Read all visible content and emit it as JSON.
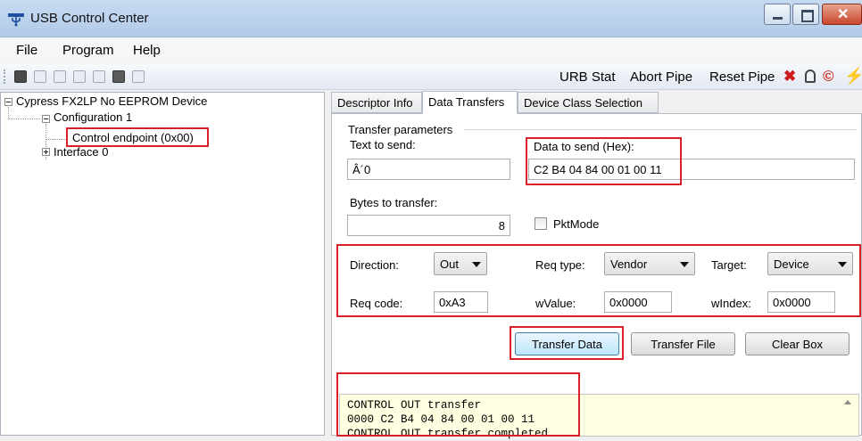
{
  "window": {
    "title": "USB Control Center"
  },
  "menu": {
    "items": [
      "File",
      "Program",
      "Help"
    ]
  },
  "toolbar": {
    "urb_stat": "URB Stat",
    "abort_pipe": "Abort Pipe",
    "reset_pipe": "Reset Pipe"
  },
  "tree": {
    "device": "Cypress FX2LP No EEPROM Device",
    "configuration": "Configuration 1",
    "endpoint": "Control endpoint (0x00)",
    "interface": "Interface 0"
  },
  "tabs": [
    "Descriptor Info",
    "Data Transfers",
    "Device Class Selection"
  ],
  "transfer": {
    "group_label": "Transfer parameters",
    "text_to_send_label": "Text to send:",
    "text_to_send_value": "Â´0",
    "hex_label": "Data to send (Hex):",
    "hex_value": "C2 B4 04 84 00 01 00 11",
    "bytes_label": "Bytes to transfer:",
    "bytes_value": "8",
    "pktmode_label": "PktMode",
    "direction_label": "Direction:",
    "direction_value": "Out",
    "reqtype_label": "Req type:",
    "reqtype_value": "Vendor",
    "target_label": "Target:",
    "target_value": "Device",
    "reqcode_label": "Req code:",
    "reqcode_value": "0xA3",
    "wvalue_label": "wValue:",
    "wvalue_value": "0x0000",
    "windex_label": "wIndex:",
    "windex_value": "0x0000"
  },
  "buttons": {
    "transfer_data": "Transfer Data",
    "transfer_file": "Transfer File",
    "clear_box": "Clear Box"
  },
  "output": {
    "lines": [
      "CONTROL OUT transfer",
      "0000 C2 B4 04 84 00 01 00 11",
      "CONTROL OUT transfer completed"
    ]
  },
  "colors": {
    "highlight": "#d8202b",
    "output_bg": "#ffffe1"
  }
}
